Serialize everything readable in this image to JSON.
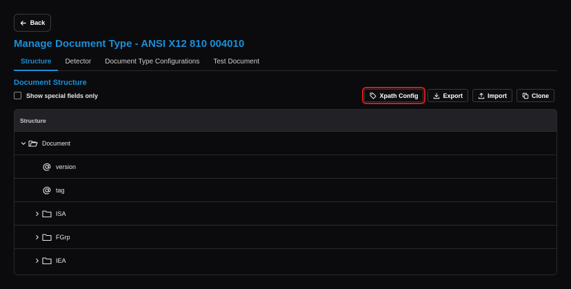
{
  "back_button": {
    "label": "Back",
    "icon": "arrow-left-icon"
  },
  "page_title": "Manage Document Type - ANSI X12 810 004010",
  "tabs": [
    {
      "label": "Structure",
      "active": true
    },
    {
      "label": "Detector",
      "active": false
    },
    {
      "label": "Document Type Configurations",
      "active": false
    },
    {
      "label": "Test Document",
      "active": false
    }
  ],
  "section_title": "Document Structure",
  "special_fields_checkbox": {
    "label": "Show special fields only",
    "checked": false
  },
  "toolbar": {
    "xpath_config": {
      "label": "Xpath Config",
      "icon": "tag-icon",
      "highlighted": true
    },
    "export": {
      "label": "Export",
      "icon": "download-icon"
    },
    "import": {
      "label": "Import",
      "icon": "upload-icon"
    },
    "clone": {
      "label": "Clone",
      "icon": "copy-icon"
    }
  },
  "table": {
    "header": "Structure",
    "rows": [
      {
        "label": "Document",
        "icon": "folder-open-icon",
        "expander": "chevron-down-icon",
        "level": 0
      },
      {
        "label": "version",
        "icon": "at-sign-icon",
        "level": 1
      },
      {
        "label": "tag",
        "icon": "at-sign-icon",
        "level": 1
      },
      {
        "label": "ISA",
        "icon": "folder-icon",
        "expander": "chevron-right-icon",
        "level": 1
      },
      {
        "label": "FGrp",
        "icon": "folder-icon",
        "expander": "chevron-right-icon",
        "level": 1
      },
      {
        "label": "IEA",
        "icon": "folder-icon",
        "expander": "chevron-right-icon",
        "level": 1
      }
    ]
  },
  "colors": {
    "accent": "#1a8fd8",
    "highlight_outline": "#d81b1b",
    "background": "#0b0b0d"
  }
}
